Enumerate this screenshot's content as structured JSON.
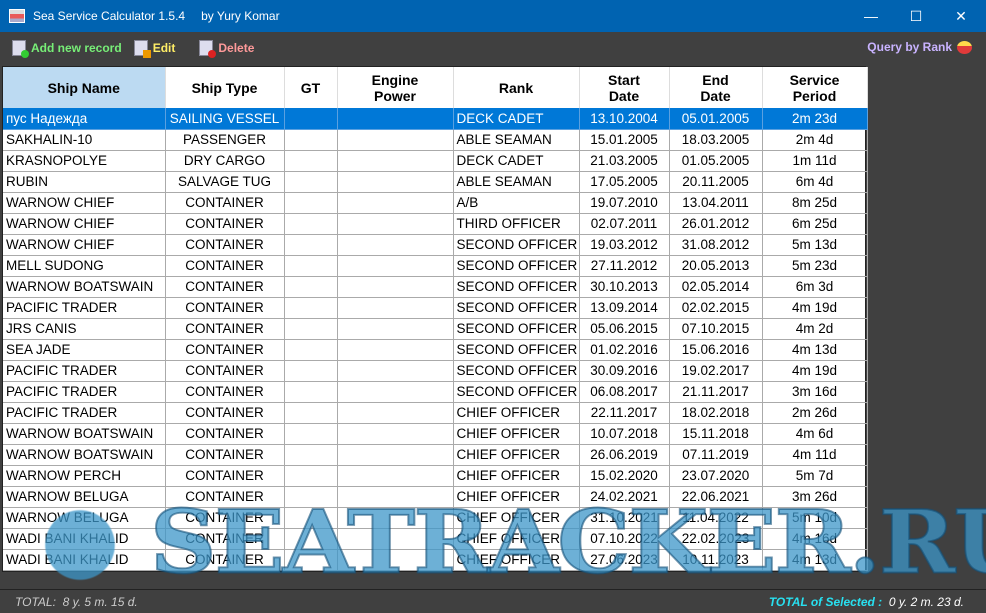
{
  "window": {
    "title": "Sea Service Calculator 1.5.4",
    "author": "by Yury Komar",
    "minimize": "—",
    "maximize": "☐",
    "close": "✕"
  },
  "toolbar": {
    "add": "Add new record",
    "edit": "Edit",
    "delete": "Delete",
    "query": "Query by Rank"
  },
  "colors": {
    "add": "#77ee77",
    "edit": "#ffee66",
    "delete": "#ff9a9a",
    "query": "#c9b3ff",
    "selection": "#0078d7"
  },
  "columns": [
    "Ship Name",
    "Ship Type",
    "GT",
    "Engine\nPower",
    "Rank",
    "Start\nDate",
    "End\nDate",
    "Service\nPeriod"
  ],
  "rows": [
    [
      "пус Надежда",
      "SAILING VESSEL",
      "",
      "",
      "DECK CADET",
      "13.10.2004",
      "05.01.2005",
      "2m 23d"
    ],
    [
      "SAKHALIN-10",
      "PASSENGER",
      "",
      "",
      "ABLE SEAMAN",
      "15.01.2005",
      "18.03.2005",
      "2m 4d"
    ],
    [
      "KRASNOPOLYE",
      "DRY CARGO",
      "",
      "",
      "DECK CADET",
      "21.03.2005",
      "01.05.2005",
      "1m 11d"
    ],
    [
      "RUBIN",
      "SALVAGE TUG",
      "",
      "",
      "ABLE SEAMAN",
      "17.05.2005",
      "20.11.2005",
      "6m 4d"
    ],
    [
      "WARNOW CHIEF",
      "CONTAINER",
      "",
      "",
      "A/B",
      "19.07.2010",
      "13.04.2011",
      "8m 25d"
    ],
    [
      "WARNOW CHIEF",
      "CONTAINER",
      "",
      "",
      "THIRD OFFICER",
      "02.07.2011",
      "26.01.2012",
      "6m 25d"
    ],
    [
      "WARNOW CHIEF",
      "CONTAINER",
      "",
      "",
      "SECOND OFFICER",
      "19.03.2012",
      "31.08.2012",
      "5m 13d"
    ],
    [
      "MELL SUDONG",
      "CONTAINER",
      "",
      "",
      "SECOND OFFICER",
      "27.11.2012",
      "20.05.2013",
      "5m 23d"
    ],
    [
      "WARNOW BOATSWAIN",
      "CONTAINER",
      "",
      "",
      "SECOND OFFICER",
      "30.10.2013",
      "02.05.2014",
      "6m 3d"
    ],
    [
      "PACIFIC TRADER",
      "CONTAINER",
      "",
      "",
      "SECOND OFFICER",
      "13.09.2014",
      "02.02.2015",
      "4m 19d"
    ],
    [
      "JRS CANIS",
      "CONTAINER",
      "",
      "",
      "SECOND OFFICER",
      "05.06.2015",
      "07.10.2015",
      "4m 2d"
    ],
    [
      "SEA JADE",
      "CONTAINER",
      "",
      "",
      "SECOND OFFICER",
      "01.02.2016",
      "15.06.2016",
      "4m 13d"
    ],
    [
      "PACIFIC TRADER",
      "CONTAINER",
      "",
      "",
      "SECOND OFFICER",
      "30.09.2016",
      "19.02.2017",
      "4m 19d"
    ],
    [
      "PACIFIC TRADER",
      "CONTAINER",
      "",
      "",
      "SECOND OFFICER",
      "06.08.2017",
      "21.11.2017",
      "3m 16d"
    ],
    [
      "PACIFIC TRADER",
      "CONTAINER",
      "",
      "",
      "CHIEF OFFICER",
      "22.11.2017",
      "18.02.2018",
      "2m 26d"
    ],
    [
      "WARNOW BOATSWAIN",
      "CONTAINER",
      "",
      "",
      "CHIEF OFFICER",
      "10.07.2018",
      "15.11.2018",
      "4m 6d"
    ],
    [
      "WARNOW BOATSWAIN",
      "CONTAINER",
      "",
      "",
      "CHIEF OFFICER",
      "26.06.2019",
      "07.11.2019",
      "4m 11d"
    ],
    [
      "WARNOW PERCH",
      "CONTAINER",
      "",
      "",
      "CHIEF OFFICER",
      "15.02.2020",
      "23.07.2020",
      "5m 7d"
    ],
    [
      "WARNOW BELUGA",
      "CONTAINER",
      "",
      "",
      "CHIEF OFFICER",
      "24.02.2021",
      "22.06.2021",
      "3m 26d"
    ],
    [
      "WARNOW BELUGA",
      "CONTAINER",
      "",
      "",
      "CHIEF OFFICER",
      "31.10.2021",
      "11.04.2022",
      "5m 10d"
    ],
    [
      "WADI BANI KHALID",
      "CONTAINER",
      "",
      "",
      "CHIEF OFFICER",
      "07.10.2022",
      "22.02.2023",
      "4m 16d"
    ],
    [
      "WADI BANI KHALID",
      "CONTAINER",
      "",
      "",
      "CHIEF OFFICER",
      "27.06.2023",
      "10.11.2023",
      "4m 13d"
    ]
  ],
  "selected_row": 0,
  "status": {
    "total_label": "TOTAL:",
    "total_value": "8 y. 5 m. 15 d.",
    "selected_label": "TOTAL of Selected :",
    "selected_value": "0 y. 2 m. 23 d."
  },
  "watermark": "SEATRACKER.RU"
}
